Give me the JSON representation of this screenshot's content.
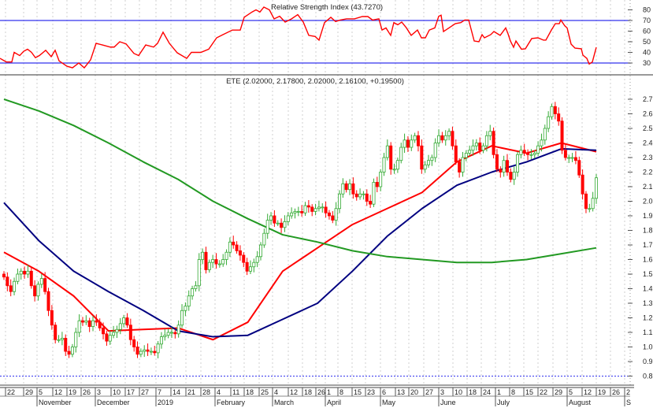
{
  "chart_data": [
    {
      "type": "line",
      "title": "Relative Strength Index (43.7270)",
      "ylim": [
        20,
        85
      ],
      "y_ticks": [
        "80",
        "70",
        "60",
        "50",
        "40",
        "30"
      ],
      "reference_lines": [
        70,
        30
      ],
      "series": [
        {
          "name": "RSI",
          "color": "#ff0000",
          "points": [
            [
              0,
              34.4
            ],
            [
              8,
              31
            ],
            [
              15,
              31
            ],
            [
              18,
              40
            ],
            [
              25,
              37
            ],
            [
              30,
              41
            ],
            [
              35,
              43
            ],
            [
              40,
              40
            ],
            [
              45,
              35
            ],
            [
              50,
              37
            ],
            [
              58,
              42
            ],
            [
              65,
              36
            ],
            [
              70,
              42
            ],
            [
              75,
              32
            ],
            [
              85,
              27
            ],
            [
              92,
              25.5
            ],
            [
              100,
              30
            ],
            [
              107,
              25.5
            ],
            [
              115,
              33
            ],
            [
              122,
              48.5
            ],
            [
              130,
              47
            ],
            [
              140,
              45
            ],
            [
              145,
              45
            ],
            [
              152,
              50
            ],
            [
              160,
              48
            ],
            [
              170,
              39
            ],
            [
              176,
              37
            ],
            [
              185,
              47
            ],
            [
              195,
              45
            ],
            [
              200,
              48.5
            ],
            [
              207,
              59
            ],
            [
              215,
              48.5
            ],
            [
              225,
              39.6
            ],
            [
              237,
              34.4
            ],
            [
              243,
              40
            ],
            [
              255,
              40
            ],
            [
              265,
              43
            ],
            [
              275,
              53.7
            ],
            [
              283,
              56.7
            ],
            [
              295,
              61
            ],
            [
              305,
              61
            ],
            [
              310,
              73
            ],
            [
              320,
              78
            ],
            [
              325,
              80
            ],
            [
              330,
              78
            ],
            [
              335,
              82.6
            ],
            [
              342,
              80
            ],
            [
              348,
              71.5
            ],
            [
              355,
              74
            ],
            [
              362,
              68.5
            ],
            [
              370,
              71.5
            ],
            [
              378,
              75.5
            ],
            [
              385,
              68.5
            ],
            [
              392,
              56
            ],
            [
              400,
              55
            ],
            [
              405,
              51.5
            ],
            [
              412,
              68
            ],
            [
              420,
              73
            ],
            [
              426,
              69
            ],
            [
              432,
              70.4
            ],
            [
              440,
              71.5
            ],
            [
              450,
              71.5
            ],
            [
              460,
              73.7
            ],
            [
              467,
              73.7
            ],
            [
              473,
              70.4
            ],
            [
              481,
              71.5
            ],
            [
              485,
              61
            ],
            [
              490,
              63
            ],
            [
              496,
              56
            ],
            [
              500,
              68
            ],
            [
              505,
              66
            ],
            [
              510,
              68.5
            ],
            [
              516,
              63
            ],
            [
              522,
              56
            ],
            [
              530,
              61
            ],
            [
              535,
              53.7
            ],
            [
              540,
              53.7
            ],
            [
              545,
              61
            ],
            [
              552,
              63
            ],
            [
              557,
              74
            ],
            [
              560,
              75
            ],
            [
              563,
              59.6
            ],
            [
              570,
              63
            ],
            [
              578,
              67
            ],
            [
              585,
              68
            ],
            [
              590,
              70.4
            ],
            [
              595,
              70.4
            ],
            [
              602,
              50.7
            ],
            [
              608,
              50
            ],
            [
              612,
              56.7
            ],
            [
              615,
              53.7
            ],
            [
              623,
              56.7
            ],
            [
              627,
              59.6
            ],
            [
              635,
              56
            ],
            [
              642,
              63
            ],
            [
              645,
              57.4
            ],
            [
              648,
              50.7
            ],
            [
              652,
              44.8
            ],
            [
              655,
              50.7
            ],
            [
              662,
              43
            ],
            [
              667,
              43.4
            ],
            [
              675,
              53
            ],
            [
              683,
              53.7
            ],
            [
              690,
              51.5
            ],
            [
              693,
              51.5
            ],
            [
              700,
              61
            ],
            [
              705,
              67
            ],
            [
              710,
              67
            ],
            [
              712,
              70.4
            ],
            [
              717,
              65
            ],
            [
              720,
              63
            ],
            [
              725,
              47.8
            ],
            [
              730,
              44
            ],
            [
              738,
              43.4
            ],
            [
              740,
              37.4
            ],
            [
              745,
              34.4
            ],
            [
              748,
              29
            ],
            [
              752,
              31
            ],
            [
              757,
              44.8
            ]
          ],
          "x_units": "trading-session-scale (0-757)"
        }
      ]
    },
    {
      "type": "candlestick",
      "title": "ETE (2.02000, 2.17800, 2.02000, 2.16100, +0.19500)",
      "ylim": [
        0.75,
        2.8
      ],
      "y_ticks": [
        "2.7",
        "2.6",
        "2.5",
        "2.4",
        "2.3",
        "2.2",
        "2.1",
        "2.0",
        "1.9",
        "1.8",
        "1.7",
        "1.6",
        "1.5",
        "1.4",
        "1.3",
        "1.2",
        "1.1",
        "1.0",
        "0.9",
        "0.8"
      ],
      "reference_line": 0.8,
      "up_color": "#33aa33",
      "down_color": "#ff0000",
      "closes": [
        1.48,
        1.42,
        1.38,
        1.45,
        1.5,
        1.52,
        1.5,
        1.52,
        1.42,
        1.35,
        1.43,
        1.47,
        1.38,
        1.25,
        1.15,
        1.05,
        1.05,
        1.06,
        0.97,
        0.95,
        1.0,
        1.1,
        1.18,
        1.17,
        1.18,
        1.14,
        1.18,
        1.17,
        1.13,
        1.09,
        1.04,
        1.08,
        1.1,
        1.12,
        1.16,
        1.2,
        1.15,
        1.05,
        1.0,
        0.95,
        0.97,
        0.98,
        0.97,
        0.97,
        0.96,
        1.02,
        1.07,
        1.08,
        1.1,
        1.1,
        1.09,
        1.15,
        1.25,
        1.28,
        1.35,
        1.4,
        1.42,
        1.6,
        1.65,
        1.53,
        1.58,
        1.6,
        1.57,
        1.57,
        1.6,
        1.65,
        1.72,
        1.7,
        1.66,
        1.63,
        1.58,
        1.52,
        1.55,
        1.58,
        1.62,
        1.7,
        1.78,
        1.87,
        1.9,
        1.85,
        1.85,
        1.82,
        1.86,
        1.9,
        1.92,
        1.93,
        1.93,
        1.92,
        1.97,
        1.96,
        1.93,
        1.95,
        1.96,
        1.96,
        1.92,
        1.9,
        1.87,
        1.95,
        2.05,
        2.12,
        2.08,
        2.12,
        2.05,
        2.03,
        2.05,
        2.05,
        2.0,
        1.98,
        2.13,
        2.1,
        2.2,
        2.3,
        2.38,
        2.22,
        2.22,
        2.28,
        2.37,
        2.42,
        2.37,
        2.42,
        2.45,
        2.38,
        2.22,
        2.25,
        2.28,
        2.3,
        2.4,
        2.45,
        2.42,
        2.45,
        2.48,
        2.38,
        2.27,
        2.2,
        2.3,
        2.33,
        2.35,
        2.38,
        2.4,
        2.35,
        2.38,
        2.45,
        2.48,
        2.32,
        2.22,
        2.2,
        2.28,
        2.2,
        2.15,
        2.2,
        2.32,
        2.35,
        2.33,
        2.32,
        2.32,
        2.33,
        2.38,
        2.42,
        2.5,
        2.58,
        2.65,
        2.6,
        2.55,
        2.35,
        2.3,
        2.3,
        2.3,
        2.28,
        2.18,
        2.05,
        1.95,
        1.95,
        2.02,
        2.161
      ],
      "moving_averages": [
        {
          "name": "short MA",
          "color": "#ff0000",
          "values": [
            1.65,
            1.52,
            1.35,
            1.11,
            1.12,
            1.13,
            1.05,
            1.17,
            1.52,
            1.68,
            1.84,
            1.95,
            2.06,
            2.27,
            2.38,
            2.33,
            2.4,
            2.34
          ]
        },
        {
          "name": "medium MA",
          "color": "#000080",
          "values": [
            1.99,
            1.73,
            1.52,
            1.38,
            1.25,
            1.11,
            1.07,
            1.08,
            1.19,
            1.3,
            1.52,
            1.76,
            1.95,
            2.11,
            2.2,
            2.27,
            2.36,
            2.35
          ]
        },
        {
          "name": "long MA",
          "color": "#229922",
          "values": [
            2.7,
            2.62,
            2.52,
            2.4,
            2.27,
            2.15,
            2.0,
            1.88,
            1.77,
            1.72,
            1.66,
            1.62,
            1.6,
            1.58,
            1.58,
            1.6,
            1.64,
            1.68
          ]
        }
      ],
      "x_axis": {
        "day_labels": [
          "22",
          "29",
          "5",
          "12",
          "19",
          "26",
          "3",
          "10",
          "17",
          "27",
          "7",
          "14",
          "21",
          "28",
          "4",
          "11",
          "18",
          "25",
          "4",
          "12",
          "18",
          "26",
          "1",
          "8",
          "15",
          "23",
          "6",
          "13",
          "20",
          "27",
          "3",
          "10",
          "18",
          "24",
          "1",
          "8",
          "15",
          "22",
          "29",
          "5",
          "12",
          "19",
          "26",
          "2"
        ],
        "month_labels": [
          "November",
          "December",
          "2019",
          "February",
          "March",
          "April",
          "May",
          "June",
          "July",
          "August",
          "S"
        ],
        "month_start_day_index": [
          2,
          6,
          10,
          14,
          18,
          22,
          26,
          30,
          34,
          39,
          43
        ]
      }
    }
  ]
}
